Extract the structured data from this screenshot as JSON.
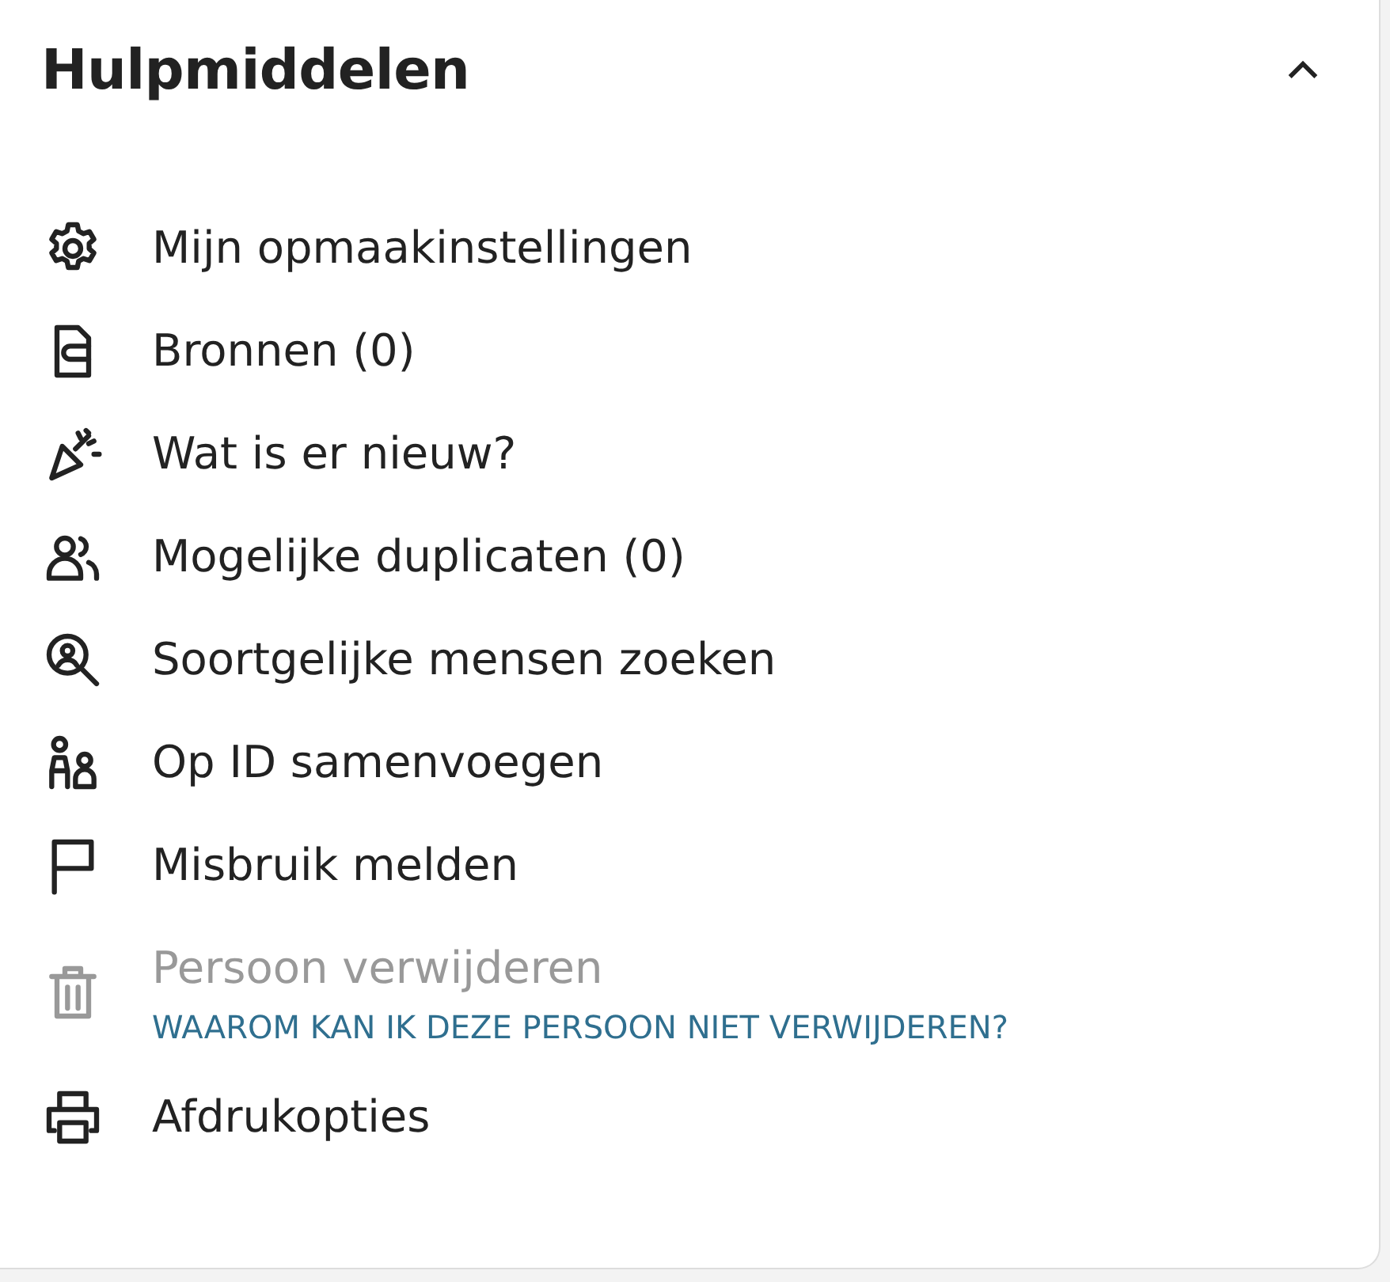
{
  "panel": {
    "title": "Hulpmiddelen",
    "expanded": true
  },
  "items": [
    {
      "label": "Mijn opmaakinstellingen",
      "disabled": false
    },
    {
      "label": "Bronnen (0)",
      "disabled": false
    },
    {
      "label": "Wat is er nieuw?",
      "disabled": false
    },
    {
      "label": "Mogelijke duplicaten (0)",
      "disabled": false
    },
    {
      "label": "Soortgelijke mensen zoeken",
      "disabled": false
    },
    {
      "label": "Op ID samenvoegen",
      "disabled": false
    },
    {
      "label": "Misbruik melden",
      "disabled": false
    },
    {
      "label": "Persoon verwijderen",
      "disabled": true,
      "link": "WAAROM KAN IK DEZE PERSOON NIET VERWIJDEREN?"
    },
    {
      "label": "Afdrukopties",
      "disabled": false
    }
  ]
}
